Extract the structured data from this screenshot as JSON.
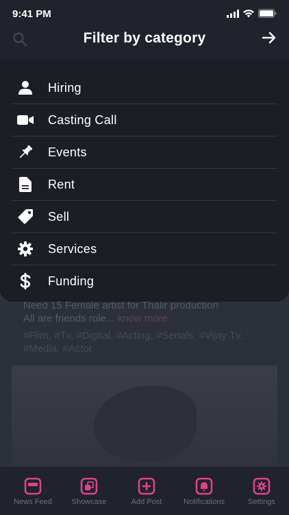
{
  "status": {
    "time": "9:41 PM"
  },
  "header": {
    "title": "Filter by category"
  },
  "categories": [
    {
      "label": "Hiring",
      "icon": "person-icon"
    },
    {
      "label": "Casting Call",
      "icon": "video-camera-icon"
    },
    {
      "label": "Events",
      "icon": "pushpin-icon"
    },
    {
      "label": "Rent",
      "icon": "document-icon"
    },
    {
      "label": "Sell",
      "icon": "tag-icon"
    },
    {
      "label": "Services",
      "icon": "gear-icon"
    },
    {
      "label": "Funding",
      "icon": "dollar-icon"
    }
  ],
  "post": {
    "text_line1": "Need 15 Female artist for Thalir production",
    "text_line2": "All are friends role...",
    "more": "know more",
    "tags_line1": "#Flim, #Tv, #Digital, #Acting, #Serials, #Vijay Tv,",
    "tags_line2": "#Media, #Actor"
  },
  "tabs": [
    {
      "label": "News Feed",
      "icon": "news-feed-icon"
    },
    {
      "label": "Showcase",
      "icon": "showcase-icon"
    },
    {
      "label": "Add Post",
      "icon": "add-post-icon"
    },
    {
      "label": "Notifications",
      "icon": "bell-icon"
    },
    {
      "label": "Settings",
      "icon": "settings-icon"
    }
  ],
  "colors": {
    "accent": "#e0408a",
    "panel": "#1b1e25",
    "background": "#2a2e38"
  }
}
